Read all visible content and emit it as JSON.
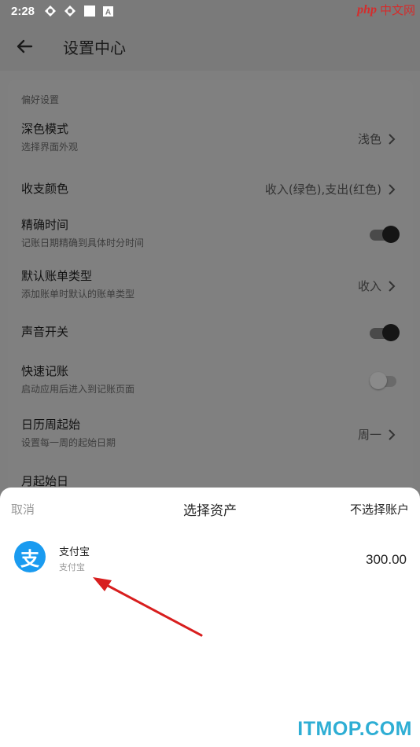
{
  "status_bar": {
    "time": "2:28",
    "watermark_php": "php",
    "watermark_cn": "中文网"
  },
  "app_bar": {
    "title": "设置中心",
    "back_icon": "arrow-left-icon"
  },
  "settings": {
    "section_header": "偏好设置",
    "rows": [
      {
        "title": "深色模式",
        "subtitle": "选择界面外观",
        "value": "浅色"
      },
      {
        "title": "收支颜色",
        "subtitle": "",
        "value": "收入(绿色),支出(红色)"
      },
      {
        "title": "精确时间",
        "subtitle": "记账日期精确到具体时分时间",
        "toggle": "on"
      },
      {
        "title": "默认账单类型",
        "subtitle": "添加账单时默认的账单类型",
        "value": "收入"
      },
      {
        "title": "声音开关",
        "subtitle": "",
        "toggle": "on"
      },
      {
        "title": "快速记账",
        "subtitle": "启动应用后进入到记账页面",
        "toggle": "off"
      },
      {
        "title": "日历周起始",
        "subtitle": "设置每一周的起始日期",
        "value": "周一"
      },
      {
        "title": "月起始日",
        "subtitle": "",
        "value": ""
      }
    ]
  },
  "sheet": {
    "cancel": "取消",
    "title": "选择资产",
    "no_account": "不选择账户",
    "assets": [
      {
        "logo_glyph": "支",
        "name": "支付宝",
        "sub": "支付宝",
        "amount": "300.00"
      }
    ]
  },
  "watermark": "ITMOP.COM",
  "colors": {
    "overlay": "#7f7f7f",
    "alipay_blue": "#1a9bf0",
    "arrow_red": "#d81e1e",
    "itmop_blue": "#2eaed4"
  }
}
